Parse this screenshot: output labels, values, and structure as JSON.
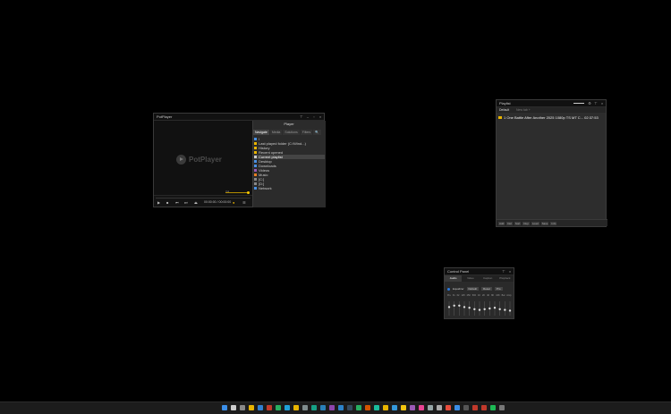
{
  "potplayer": {
    "title": "PotPlayer",
    "logo_text": "PotPlayer",
    "time": "00:00:00 / 00:00:00",
    "volume_label": "Vol",
    "playlist_header": "Player",
    "tabs": [
      "Navigate",
      "Media",
      "Solutions",
      "Filters",
      "🔍"
    ],
    "tab_settings": "⚙",
    "items": [
      {
        "label": "\\",
        "icon": "folder-icon",
        "color": "#4a90e2"
      },
      {
        "label": "Last played folder (C:\\Wind...)",
        "icon": "folder-icon",
        "color": "#e8b400"
      },
      {
        "label": "History",
        "icon": "clock-icon",
        "color": "#e8b400"
      },
      {
        "label": "Recent opened",
        "icon": "recent-icon",
        "color": "#e8b400"
      },
      {
        "label": "Current playlist",
        "icon": "playlist-icon",
        "color": "#cccccc"
      },
      {
        "label": "Desktop",
        "icon": "desktop-icon",
        "color": "#4a90e2"
      },
      {
        "label": "Downloads",
        "icon": "download-icon",
        "color": "#4a90e2"
      },
      {
        "label": "Videos",
        "icon": "video-icon",
        "color": "#9b59b6"
      },
      {
        "label": "Music",
        "icon": "music-icon",
        "color": "#e67e22"
      },
      {
        "label": "[C:]",
        "icon": "drive-icon",
        "color": "#888888"
      },
      {
        "label": "[D:]",
        "icon": "drive-icon",
        "color": "#888888"
      },
      {
        "label": "Network",
        "icon": "network-icon",
        "color": "#4a90e2"
      }
    ],
    "selected_index": 4
  },
  "playlist": {
    "title": "Playlist",
    "tab_active": "Default",
    "tab_add": "New tab  +",
    "item": "1   One Battle After Another 2025 1080p TS MT C...    02:37:53",
    "bottom_buttons": [
      "Add",
      "Del",
      "Sort",
      "Dup",
      "Load",
      "Save",
      "Info"
    ]
  },
  "control_panel": {
    "title": "Control Panel",
    "tabs": [
      "Audio",
      "Video",
      "Caption",
      "Playback"
    ],
    "equalizer_label": "Equalizer",
    "preset": "Default",
    "reset": "Reset",
    "mode": "Pro",
    "freqs": [
      "Pre",
      "31",
      "62",
      "125",
      "250",
      "500",
      "1K",
      "2K",
      "4K",
      "8K",
      "16K",
      "Bal",
      "Amp"
    ],
    "eq_levels": [
      0.6,
      0.7,
      0.7,
      0.6,
      0.55,
      0.45,
      0.4,
      0.45,
      0.5,
      0.55,
      0.45,
      0.4,
      0.35
    ]
  },
  "taskbar": {
    "icons": [
      {
        "name": "windows-start-icon",
        "color": "#3b8ee8"
      },
      {
        "name": "search-icon",
        "color": "#cccccc"
      },
      {
        "name": "task-view-icon",
        "color": "#888888"
      },
      {
        "name": "file-explorer-icon",
        "color": "#e8b400"
      },
      {
        "name": "mail-icon",
        "color": "#2f7fd1"
      },
      {
        "name": "app-icon-1",
        "color": "#c0392b"
      },
      {
        "name": "app-icon-2",
        "color": "#27ae60"
      },
      {
        "name": "edge-icon",
        "color": "#1fa0d8"
      },
      {
        "name": "chrome-icon",
        "color": "#e8b400"
      },
      {
        "name": "app-icon-3",
        "color": "#7f8c8d"
      },
      {
        "name": "app-icon-4",
        "color": "#16a085"
      },
      {
        "name": "app-icon-5",
        "color": "#2980b9"
      },
      {
        "name": "app-icon-6",
        "color": "#8e44ad"
      },
      {
        "name": "app-icon-7",
        "color": "#2c82c9"
      },
      {
        "name": "app-icon-8",
        "color": "#34495e"
      },
      {
        "name": "app-icon-9",
        "color": "#27ae60"
      },
      {
        "name": "app-icon-10",
        "color": "#d35400"
      },
      {
        "name": "app-icon-11",
        "color": "#1abc9c"
      },
      {
        "name": "app-icon-12",
        "color": "#e8b400"
      },
      {
        "name": "app-icon-13",
        "color": "#3498db"
      },
      {
        "name": "app-icon-14",
        "color": "#f1c40f"
      },
      {
        "name": "app-icon-15",
        "color": "#9b59b6"
      },
      {
        "name": "app-icon-16",
        "color": "#e84393"
      },
      {
        "name": "app-icon-17",
        "color": "#95a5a6"
      },
      {
        "name": "app-icon-18",
        "color": "#aaaaaa"
      },
      {
        "name": "app-icon-19",
        "color": "#e74c3c"
      },
      {
        "name": "app-icon-20",
        "color": "#3b8ee8"
      },
      {
        "name": "app-icon-21",
        "color": "#555555"
      },
      {
        "name": "app-icon-22",
        "color": "#c0392b"
      },
      {
        "name": "app-icon-23",
        "color": "#c0392b"
      },
      {
        "name": "spotify-icon",
        "color": "#1db954"
      },
      {
        "name": "app-icon-24",
        "color": "#777777"
      }
    ]
  }
}
